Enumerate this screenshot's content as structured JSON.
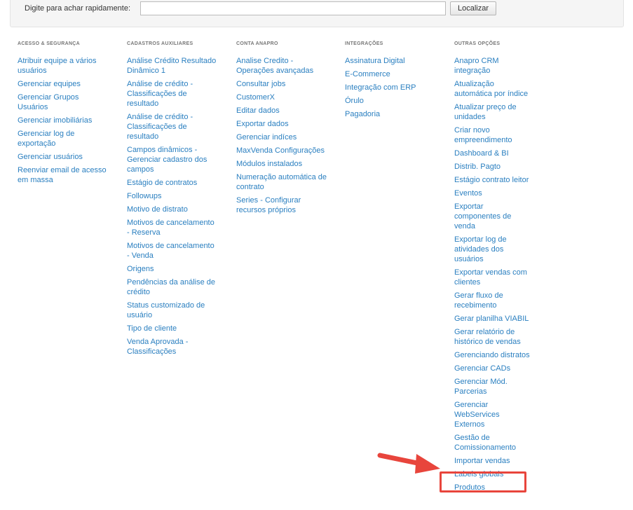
{
  "search": {
    "label": "Digite para achar rapidamente:",
    "value": "",
    "button_label": "Localizar"
  },
  "columns": [
    {
      "title": "ACESSO & SEGURANÇA",
      "items": [
        "Atribuir equipe a vários usuários",
        "Gerenciar equipes",
        "Gerenciar Grupos Usuários",
        "Gerenciar imobiliárias",
        "Gerenciar log de exportação",
        "Gerenciar usuários",
        "Reenviar email de acesso em massa"
      ]
    },
    {
      "title": "CADASTROS AUXILIARES",
      "items": [
        "Análise Crédito Resultado Dinâmico 1",
        "Análise de crédito - Classificações de resultado",
        "Análise de crédito - Classificações de resultado",
        "Campos dinâmicos - Gerenciar cadastro dos campos",
        "Estágio de contratos",
        "Followups",
        "Motivo de distrato",
        "Motivos de cancelamento - Reserva",
        "Motivos de cancelamento - Venda",
        "Origens",
        "Pendências da análise de crédito",
        "Status customizado de usuário",
        "Tipo de cliente",
        "Venda Aprovada - Classificações"
      ]
    },
    {
      "title": "CONTA ANAPRO",
      "items": [
        "Analise Credito - Operações avançadas",
        "Consultar jobs",
        "CustomerX",
        "Editar dados",
        "Exportar dados",
        "Gerenciar indíces",
        "MaxVenda Configurações",
        "Módulos instalados",
        "Numeração automática de contrato",
        "Series - Configurar recursos próprios"
      ]
    },
    {
      "title": "INTEGRAÇÕES",
      "items": [
        "Assinatura Digital",
        "E-Commerce",
        "Integração com ERP",
        "Órulo",
        "Pagadoria"
      ]
    },
    {
      "title": "OUTRAS OPÇÕES",
      "items": [
        "Anapro CRM integração",
        "Atualização automática por índice",
        "Atualizar preço de unidades",
        "Criar novo empreendimento",
        "Dashboard & BI",
        "Distrib. Pagto",
        "Estágio contrato leitor",
        "Eventos",
        "Exportar componentes de venda",
        "Exportar log de atividades dos usuários",
        "Exportar vendas com clientes",
        "Gerar fluxo de recebimento",
        "Gerar planilha VIABIL",
        "Gerar relatório de histórico de vendas",
        "Gerenciando distratos",
        "Gerenciar CADs",
        "Gerenciar Mód. Parcerias",
        "Gerenciar WebServices Externos",
        "Gestão de Comissionamento",
        "Importar vendas",
        "Labels globais",
        "Produtos"
      ]
    }
  ],
  "annotation": {
    "highlighted_item": "Importar vendas",
    "arrow_color": "#e8453c",
    "box_color": "#e8453c"
  },
  "colors": {
    "link": "#2a7fc0",
    "heading": "#777777",
    "panel_bg": "#f5f5f5"
  }
}
